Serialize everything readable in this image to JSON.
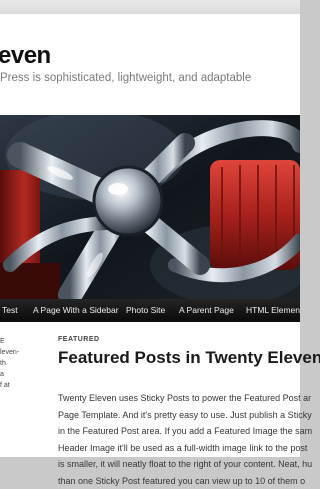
{
  "site": {
    "title": "even",
    "description": "Press is sophisticated, lightweight, and adaptable"
  },
  "header_image": {
    "alt": ""
  },
  "nav": {
    "items": [
      {
        "label": "Test"
      },
      {
        "label": "A Page With a Sidebar"
      },
      {
        "label": "Photo Site"
      },
      {
        "label": "A Parent Page"
      },
      {
        "label": "HTML Elements"
      }
    ]
  },
  "sidebar_fragment": {
    "lines": [
      "E",
      "leven-",
      "th",
      "a",
      "f at"
    ]
  },
  "post": {
    "category": "FEATURED",
    "title": "Featured Posts in Twenty Eleven",
    "lines": [
      "Twenty Eleven uses Sticky Posts to power the Featured Post ar",
      "Page Template. And it's pretty easy to use. Just publish a Sticky",
      "in the Featured Post area. If you add a Featured Image the sam",
      "Header Image it'll be used as a full-width image link to the post",
      "is smaller, it will neatly float to the right of your content. Neat, hu",
      "than one Sticky Post featured you can view up to 10 of them o"
    ]
  }
}
